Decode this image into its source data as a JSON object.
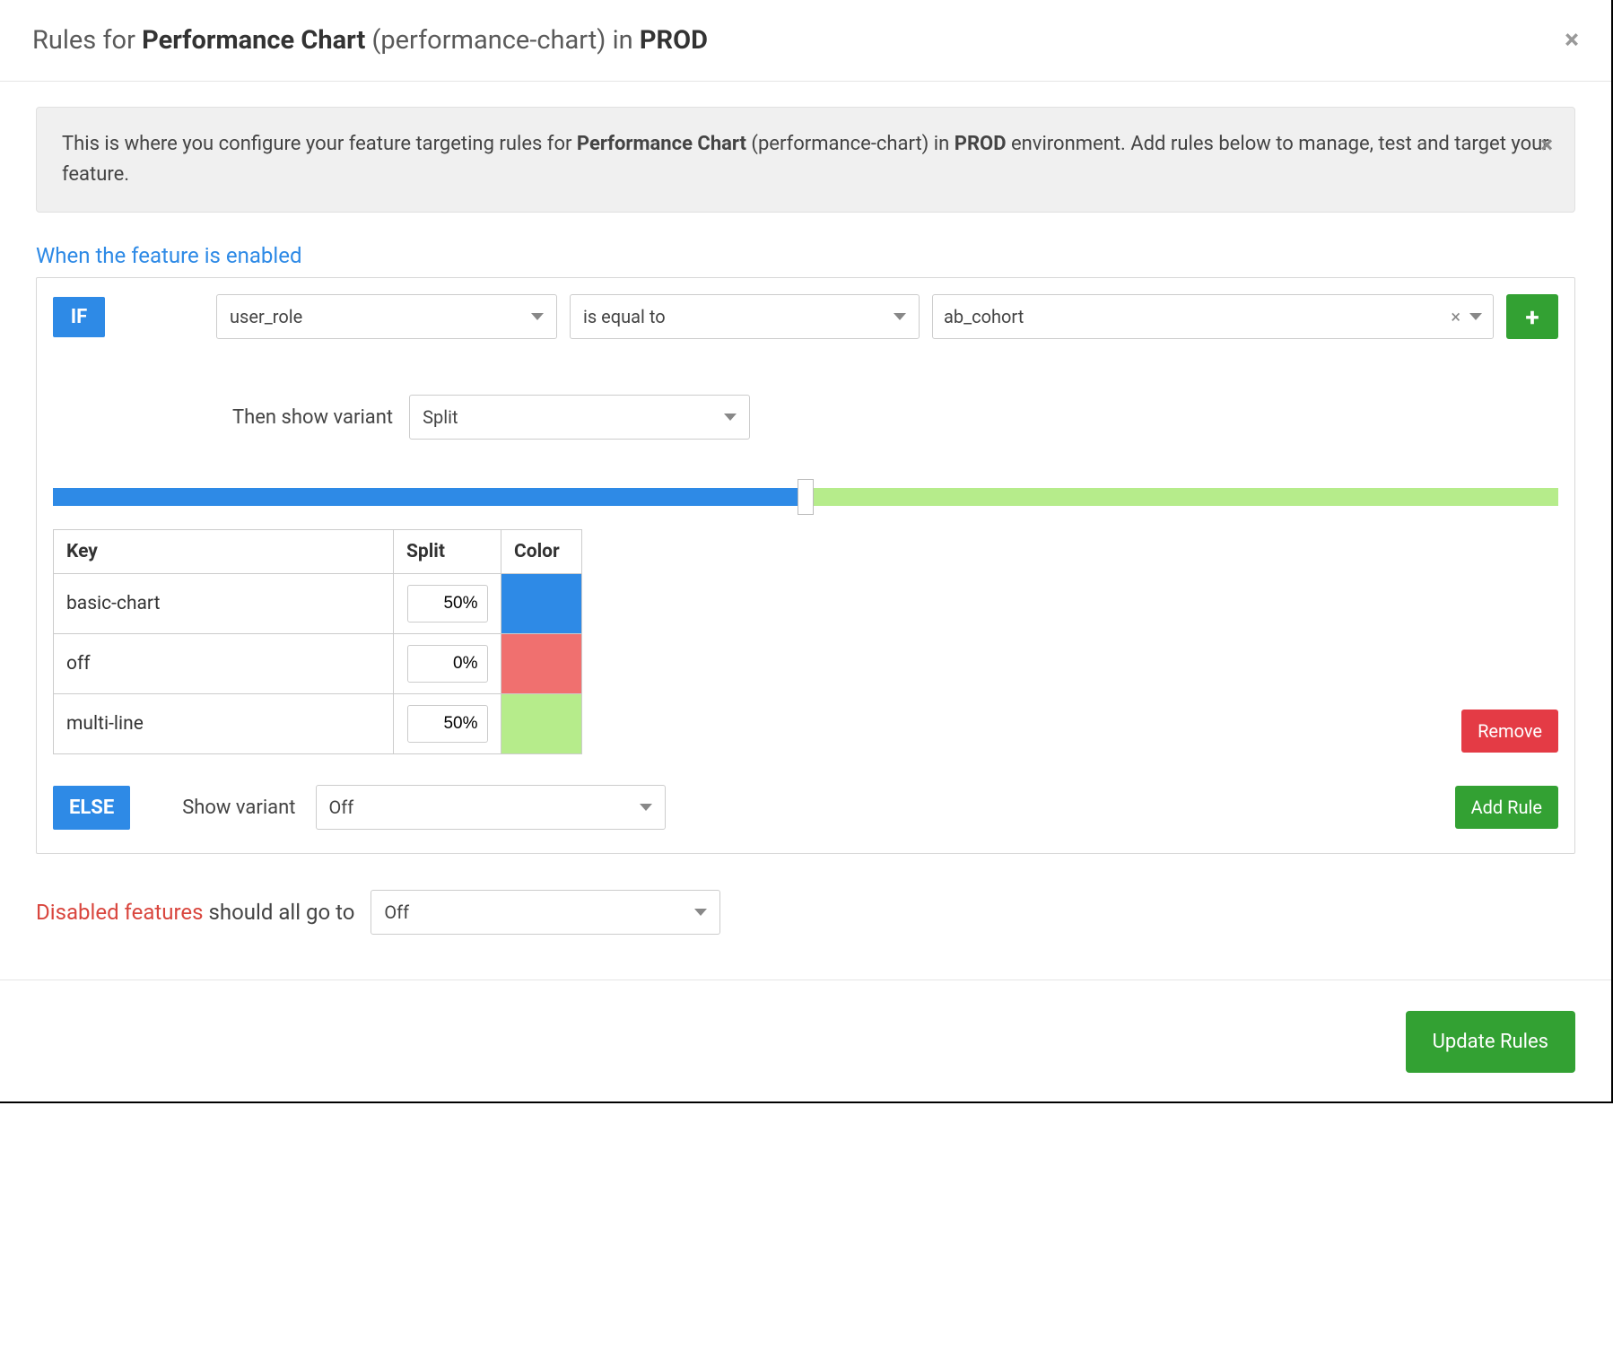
{
  "header": {
    "prefix": "Rules for ",
    "feature_bold": "Performance Chart",
    "feature_slug": " (performance-chart) in ",
    "env_bold": "PROD"
  },
  "banner": {
    "pre": "This is where you configure your feature targeting rules for ",
    "feature_bold": "Performance Chart",
    "mid": " (performance-chart) in ",
    "env_bold": "PROD",
    "post": " environment. Add rules below to manage, test and target your feature."
  },
  "section_enabled": "When the feature is enabled",
  "rule": {
    "if_label": "IF",
    "attribute": "user_role",
    "operator": "is equal to",
    "value": "ab_cohort",
    "then_label": "Then show variant",
    "variant_mode": "Split",
    "table": {
      "headers": {
        "key": "Key",
        "split": "Split",
        "color": "Color"
      },
      "rows": [
        {
          "key": "basic-chart",
          "split": "50%",
          "color": "#2e8ae6"
        },
        {
          "key": "off",
          "split": "0%",
          "color": "#f0706f"
        },
        {
          "key": "multi-line",
          "split": "50%",
          "color": "#b6ec8b"
        }
      ]
    },
    "remove_label": "Remove",
    "else_label": "ELSE",
    "else_show": "Show variant",
    "else_variant": "Off",
    "add_rule_label": "Add Rule"
  },
  "disabled": {
    "red": "Disabled features",
    "rest": " should all go to",
    "variant": "Off"
  },
  "footer": {
    "update": "Update Rules"
  }
}
